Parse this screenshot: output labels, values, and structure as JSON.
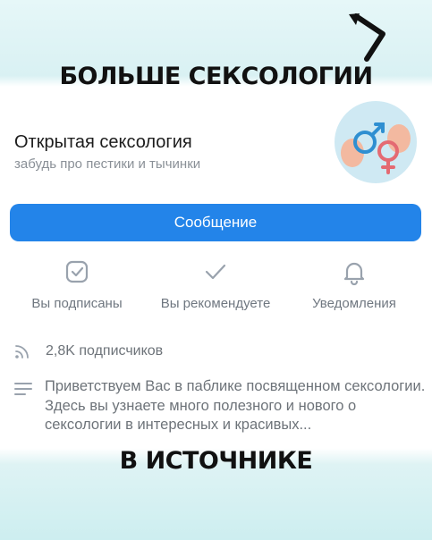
{
  "banner": {
    "top_text": "БОЛЬШЕ СЕКСОЛОГИИ",
    "bottom_text": "В ИСТОЧНИКЕ"
  },
  "profile": {
    "name": "Открытая сексология",
    "status": "забудь про пестики и тычинки"
  },
  "message_button": "Сообщение",
  "actions": [
    {
      "label": "Вы подписаны",
      "icon": "checkbox-square-icon"
    },
    {
      "label": "Вы рекомендуете",
      "icon": "checkmark-icon"
    },
    {
      "label": "Уведомления",
      "icon": "bell-icon"
    }
  ],
  "followers": "2,8K подписчиков",
  "description": "Приветствуем Вас в паблике посвященном сексологии. Здесь вы узнаете много полезного и нового о сексологии в интересных и красивых...",
  "colors": {
    "accent": "#2384e9",
    "text_primary": "#1c1c1c",
    "text_secondary": "#6d7379",
    "icon_gray": "#99a2ad"
  }
}
